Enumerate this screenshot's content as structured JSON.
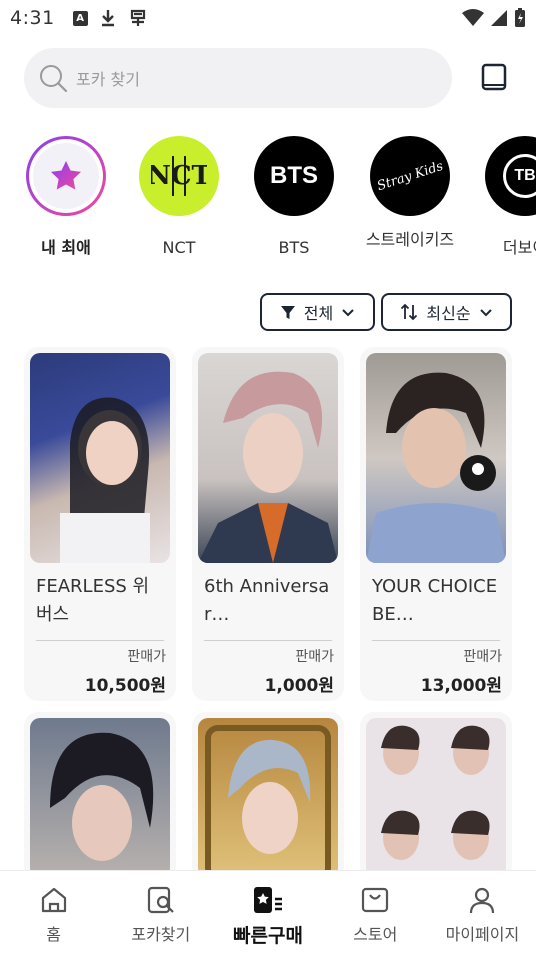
{
  "status_bar": {
    "time": "4:31"
  },
  "search": {
    "placeholder": "포카 찾기"
  },
  "artists": [
    {
      "label": "내 최애"
    },
    {
      "label": "NCT",
      "logo_text": "NCT"
    },
    {
      "label": "BTS",
      "logo_text": "BTS"
    },
    {
      "label": "스트레이키즈",
      "logo_text": "Stray Kids"
    },
    {
      "label": "더보이",
      "logo_text": "TB"
    }
  ],
  "filters": {
    "category_label": "전체",
    "sort_label": "최신순"
  },
  "cards": [
    {
      "title": "FEARLESS 위버스",
      "price_label": "판매가",
      "price": "10,500원"
    },
    {
      "title": "6th Anniversar…",
      "price_label": "판매가",
      "price": "1,000원"
    },
    {
      "title": "YOUR CHOICE BE…",
      "price_label": "판매가",
      "price": "13,000원"
    },
    {
      "title": "",
      "price_label": "",
      "price": ""
    },
    {
      "title": "",
      "price_label": "",
      "price": ""
    },
    {
      "title": "",
      "price_label": "",
      "price": ""
    }
  ],
  "bottom_nav": [
    {
      "label": "홈",
      "icon": "home-icon"
    },
    {
      "label": "포카찾기",
      "icon": "card-search-icon"
    },
    {
      "label": "빠른구매",
      "icon": "quick-buy-icon"
    },
    {
      "label": "스토어",
      "icon": "store-icon"
    },
    {
      "label": "마이페이지",
      "icon": "user-icon"
    }
  ],
  "colors": {
    "accent_dark": "#1d2535",
    "nct_green": "#c9ef2c",
    "favorite_gradient_start": "#8a3df0",
    "favorite_gradient_end": "#f04a9b"
  }
}
